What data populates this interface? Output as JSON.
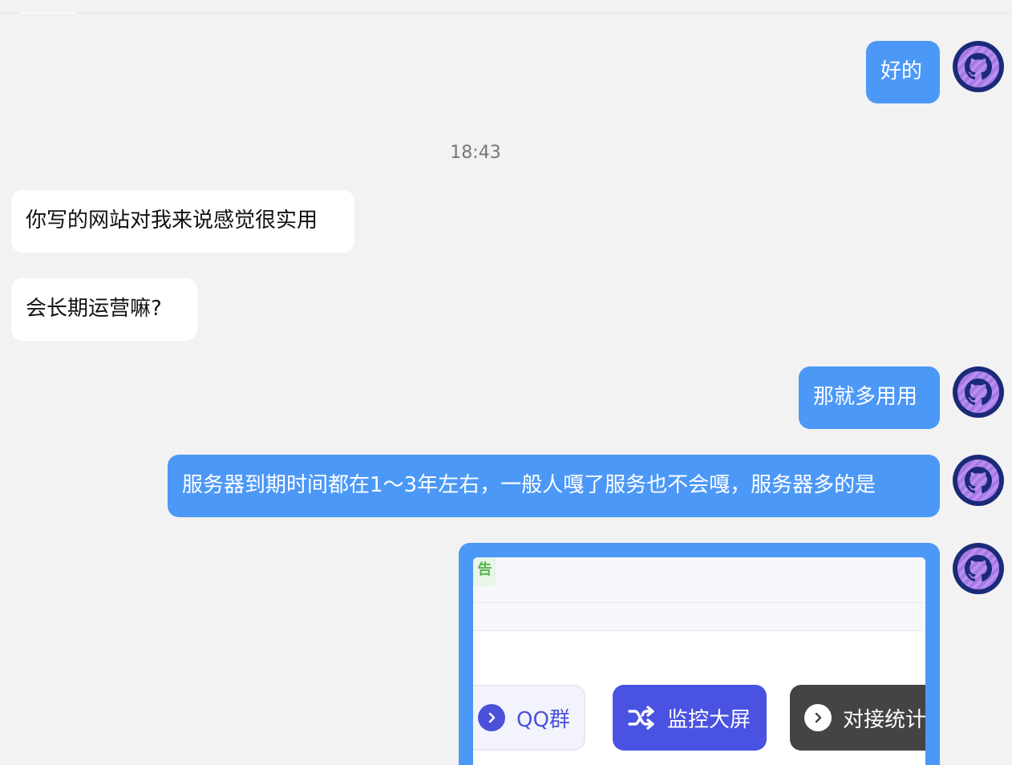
{
  "timestamp": "18:43",
  "messages": [
    {
      "id": "m1",
      "side": "out",
      "text": "好的"
    },
    {
      "id": "m2",
      "side": "in",
      "text": "你写的网站对我来说感觉很实用"
    },
    {
      "id": "m3",
      "side": "in",
      "text": "会长期运营嘛?"
    },
    {
      "id": "m4",
      "side": "out",
      "text": "那就多用用"
    },
    {
      "id": "m5",
      "side": "out",
      "text": "服务器到期时间都在1～3年左右，一般人嘎了服务也不会嘎，服务器多的是"
    }
  ],
  "screenshot_card": {
    "tag_label": "告",
    "buttons": {
      "qq_label": "QQ群",
      "monitor_label": "监控大屏",
      "stat_label": "对接统计"
    }
  },
  "icons": {
    "avatar": "github-octocat-icon",
    "qq": "chevron-right-circle-icon",
    "monitor": "shuffle-icon",
    "stat": "chevron-right-circle-icon"
  },
  "colors": {
    "outgoing_bubble": "#4c98f7",
    "incoming_bubble": "#ffffff",
    "background": "#f2f2f2",
    "avatar_ring": "#1b2a78",
    "avatar_fill": "#b98ff0",
    "monitor_button": "#4a52e2",
    "stat_button": "#444444",
    "tag_green": "#56b548"
  }
}
